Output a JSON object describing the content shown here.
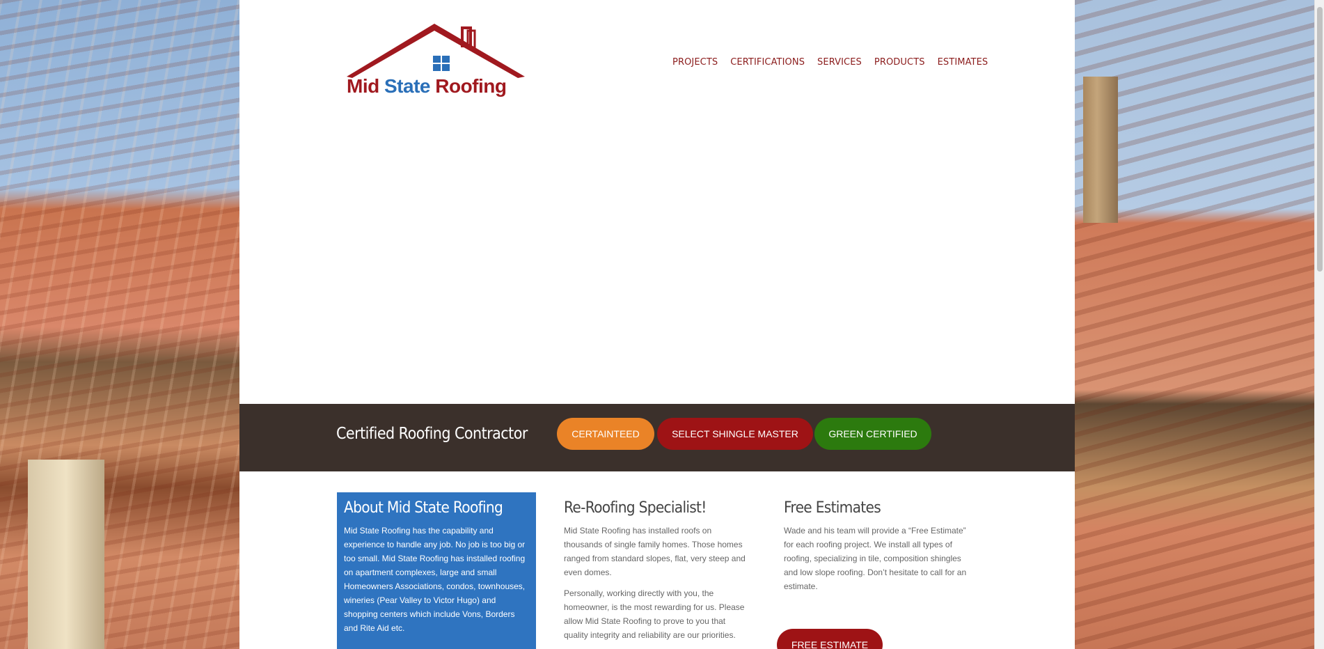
{
  "brand": {
    "logo_mid": "Mid",
    "logo_state": "State",
    "logo_roofing": "Roofing",
    "colors": {
      "red": "#a0191f",
      "blue": "#2a6fb8"
    }
  },
  "nav": {
    "items": [
      "PROJECTS",
      "CERTIFICATIONS",
      "SERVICES",
      "PRODUCTS",
      "ESTIMATES"
    ]
  },
  "cert_band": {
    "title": "Certified Roofing Contractor",
    "buttons": [
      {
        "label": "CERTAINTEED",
        "color": "#ea8327"
      },
      {
        "label": "SELECT SHINGLE MASTER",
        "color": "#9e1315"
      },
      {
        "label": "GREEN CERTIFIED",
        "color": "#2c7a0e"
      }
    ]
  },
  "about": {
    "title": "About Mid State Roofing",
    "body": "Mid State Roofing has the capability and experience to handle any job. No job is too big or too small. Mid State Roofing has installed roofing on apartment complexes, large and small Homeowners Associations, condos, townhouses, wineries (Pear Valley to Victor Hugo) and shopping centers which include Vons, Borders and Rite Aid etc."
  },
  "reroofing": {
    "title": "Re-Roofing Specialist!",
    "p1": "Mid State Roofing has installed roofs on thousands of single family homes. Those homes ranged from standard slopes, flat, very steep and even domes.",
    "p2": "Personally, working directly with you, the homeowner, is the most rewarding for us. Please allow Mid State Roofing to prove to you that quality integrity and reliability are our priorities."
  },
  "estimates": {
    "title": "Free Estimates",
    "body": "Wade and his team will provide a “Free Estimate” for each roofing project. We install all types of roofing, specializing in tile, composition shingles and low slope roofing. Don’t hesitate to call for an estimate.",
    "button_label": "FREE ESTIMATE"
  }
}
